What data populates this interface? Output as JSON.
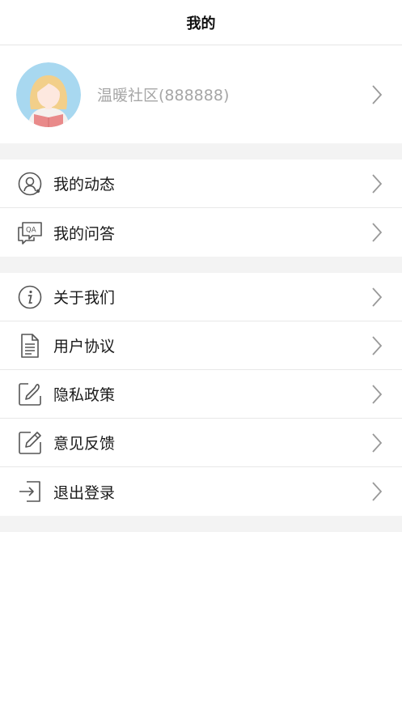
{
  "header": {
    "title": "我的"
  },
  "profile": {
    "name": "温暖社区(888888)"
  },
  "menu_group_1": [
    {
      "label": "我的动态",
      "icon": "user-activity-icon"
    },
    {
      "label": "我的问答",
      "icon": "qa-chat-icon"
    }
  ],
  "menu_group_2": [
    {
      "label": "关于我们",
      "icon": "info-icon"
    },
    {
      "label": "用户协议",
      "icon": "document-icon"
    },
    {
      "label": "隐私政策",
      "icon": "pen-sign-icon"
    },
    {
      "label": "意见反馈",
      "icon": "edit-icon"
    },
    {
      "label": "退出登录",
      "icon": "logout-icon"
    }
  ],
  "colors": {
    "separator": "#f3f3f3",
    "icon_stroke": "#555555",
    "chevron": "#999999",
    "avatar_bg": "#a8d8f0"
  }
}
